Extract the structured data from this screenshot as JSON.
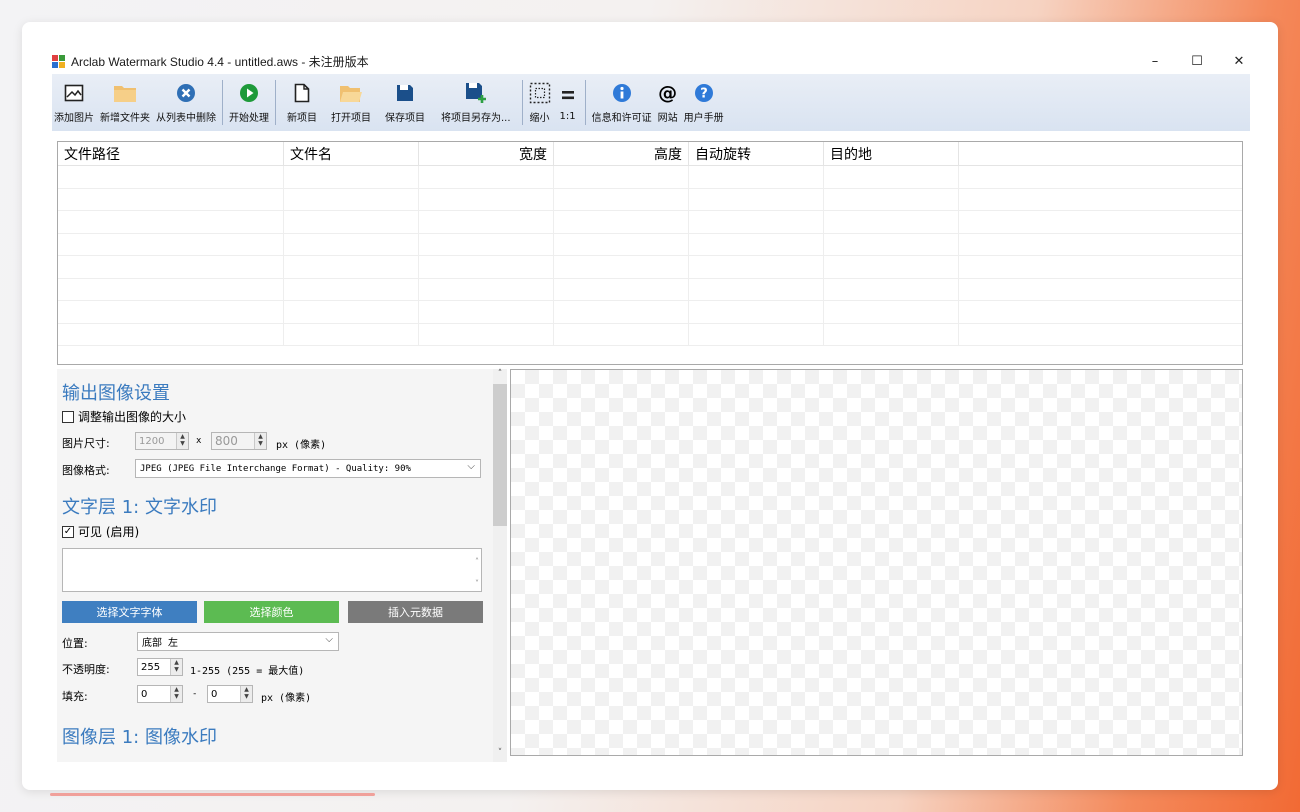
{
  "window": {
    "title": "Arclab Watermark Studio 4.4 - untitled.aws - 未注册版本",
    "controls": [
      "–",
      "☐",
      "✕"
    ]
  },
  "toolbar": {
    "add_image": "添加图片",
    "add_folder": "新增文件夹",
    "remove": "从列表中删除",
    "start": "开始处理",
    "new_project": "新项目",
    "open_project": "打开项目",
    "save_project": "保存项目",
    "save_as": "将项目另存为...",
    "shrink": "缩小",
    "one_to_one": "1:1",
    "info": "信息和许可证",
    "website": "网站",
    "manual": "用户手册"
  },
  "filelist": {
    "columns": [
      "文件路径",
      "文件名",
      "宽度",
      "高度",
      "自动旋转",
      "目的地"
    ]
  },
  "settings": {
    "output_title": "输出图像设置",
    "resize_label": "调整输出图像的大小",
    "size_label": "图片尺寸:",
    "width_value": "1200",
    "x": "x",
    "height_value": "800",
    "px_unit": "px (像素)",
    "format_label": "图像格式:",
    "format_value": "JPEG (JPEG File Interchange Format) - Quality: 90%",
    "text_layer_title": "文字层 1:  文字水印",
    "visible_label": "可见 (启用)",
    "btn_font": "选择文字字体",
    "btn_color": "选择颜色",
    "btn_meta": "插入元数据",
    "position_label": "位置:",
    "position_value": "底部 左",
    "opacity_label": "不透明度:",
    "opacity_value": "255",
    "opacity_hint": "1-255 (255 = 最大值)",
    "padding_label": "填充:",
    "padding_x": "0",
    "dash": "-",
    "padding_y": "0",
    "padding_unit": "px (像素)",
    "image_layer_title": "图像层 1:  图像水印"
  },
  "colors": {
    "accent_title": "#3b7bbf",
    "btn_font": "#3f7fc1",
    "btn_color": "#5cbb52",
    "btn_meta": "#7a7a7a"
  }
}
